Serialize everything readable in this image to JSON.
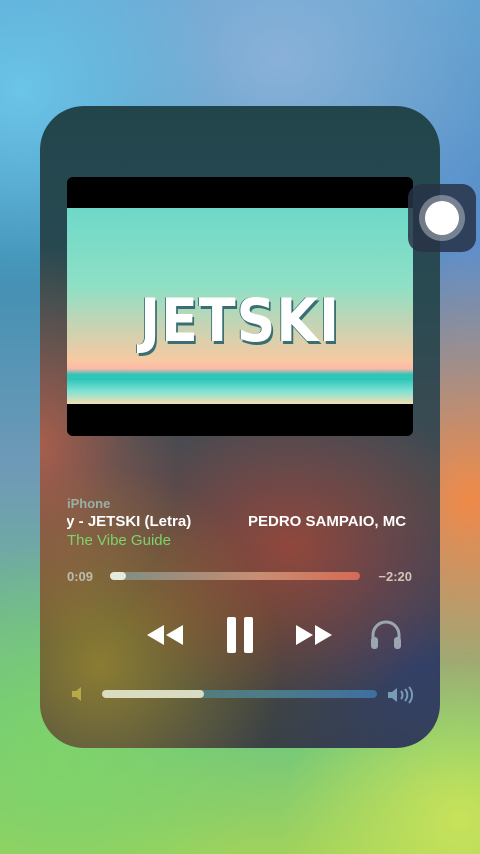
{
  "now_playing": {
    "artwork_text": "JETSKI",
    "device": "iPhone",
    "title": "dy - JETSKI (Letra)",
    "artist": "PEDRO SAMPAIO, MC",
    "album": "The Vibe Guide",
    "elapsed": "0:09",
    "remaining": "−2:20",
    "progress": 0.064,
    "volume": 0.37
  },
  "controls": {
    "rewind_icon": "rewind-icon",
    "pause_icon": "pause-icon",
    "forward_icon": "fast-forward-icon",
    "airplay_icon": "headphones-icon"
  },
  "colors": {
    "album_green": "#7fd36a",
    "accent_white": "#ffffff"
  }
}
